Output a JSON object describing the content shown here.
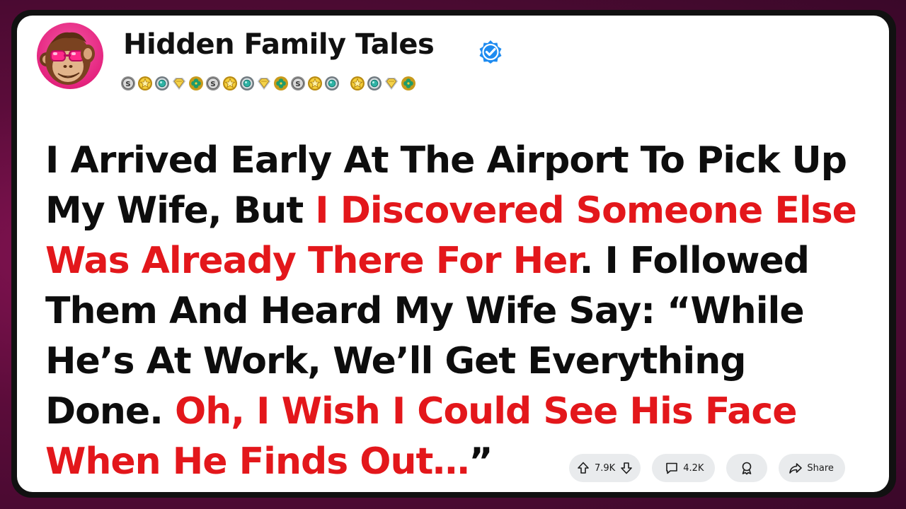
{
  "channel": {
    "name": "Hidden Family Tales",
    "verified": true,
    "avatar_icon": "monkey-with-sunglasses-icon",
    "badges": [
      "silver-s-badge-icon",
      "gold-star-badge-icon",
      "teal-gem-badge-icon",
      "diamond-badge-icon",
      "clover-badge-icon",
      "silver-s-badge-icon",
      "gold-star-badge-icon",
      "teal-gem-badge-icon",
      "diamond-badge-icon",
      "clover-badge-icon",
      "silver-s-badge-icon",
      "gold-star-badge-icon",
      "teal-gem-badge-icon",
      "gold-star-badge-icon",
      "teal-gem-badge-icon",
      "diamond-badge-icon",
      "clover-badge-icon"
    ]
  },
  "headline": {
    "segments": [
      {
        "text": "I Arrived Early At The Airport To Pick Up My Wife, But ",
        "color": "#0d0d0d"
      },
      {
        "text": "I Discovered Someone Else Was Already There For Her",
        "color": "#e3171b"
      },
      {
        "text": ". I Followed Them And Heard My Wife Say: “While He’s At Work, We’ll Get Everything Done. ",
        "color": "#0d0d0d"
      },
      {
        "text": "Oh, I Wish I Could See His Face When He Finds Out…",
        "color": "#e3171b"
      },
      {
        "text": "”",
        "color": "#0d0d0d"
      }
    ]
  },
  "actions": {
    "votes": "7.9K",
    "comments": "4.2K",
    "share_label": "Share"
  },
  "colors": {
    "accent_red": "#e3171b",
    "verified_blue": "#1e8bf0",
    "background": "#6e0f47",
    "pill_bg": "#e9ebed"
  }
}
